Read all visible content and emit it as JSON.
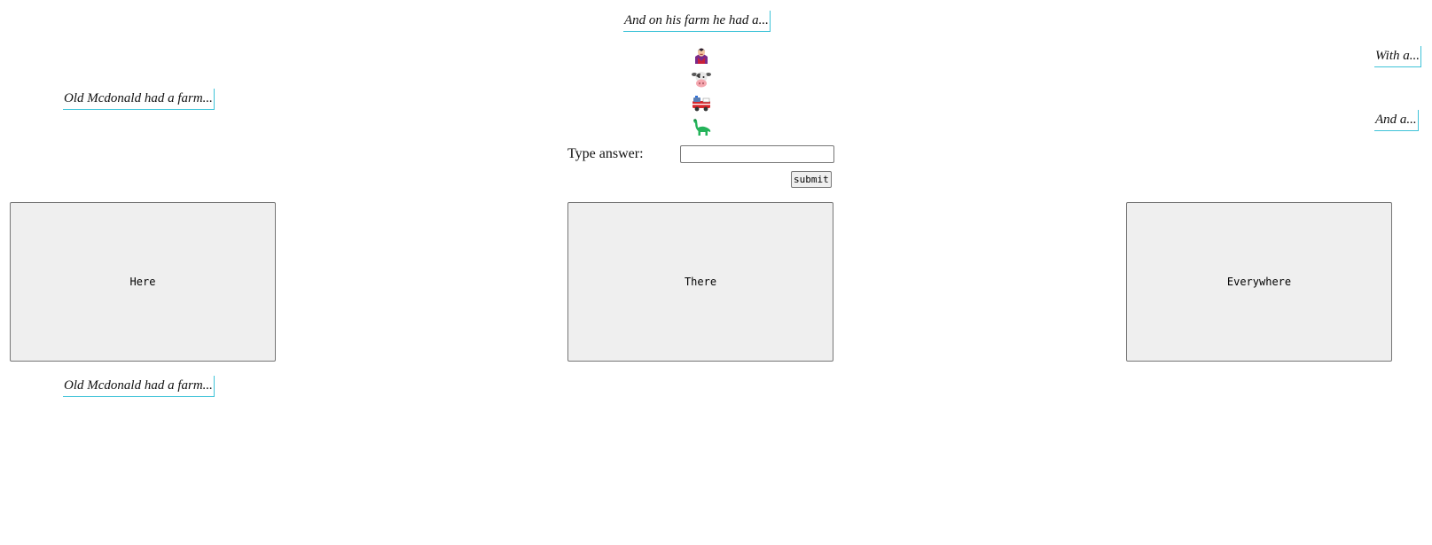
{
  "lyrics": {
    "top_center": "And on his farm he had a...",
    "left_upper": "Old Mcdonald had a farm...",
    "right_upper": "With a...",
    "right_lower": "And a...",
    "left_lower": "Old Mcdonald had a farm..."
  },
  "emojis": [
    "vampire-icon",
    "cow-face-icon",
    "fire-engine-icon",
    "sauropod-icon"
  ],
  "form": {
    "label": "Type answer:",
    "input_value": "",
    "input_placeholder": "",
    "submit_label": "submit"
  },
  "choices": {
    "here": "Here",
    "there": "There",
    "everywhere": "Everywhere"
  },
  "colors": {
    "lyric_border": "#3fc3d8",
    "button_bg": "#efefef"
  }
}
